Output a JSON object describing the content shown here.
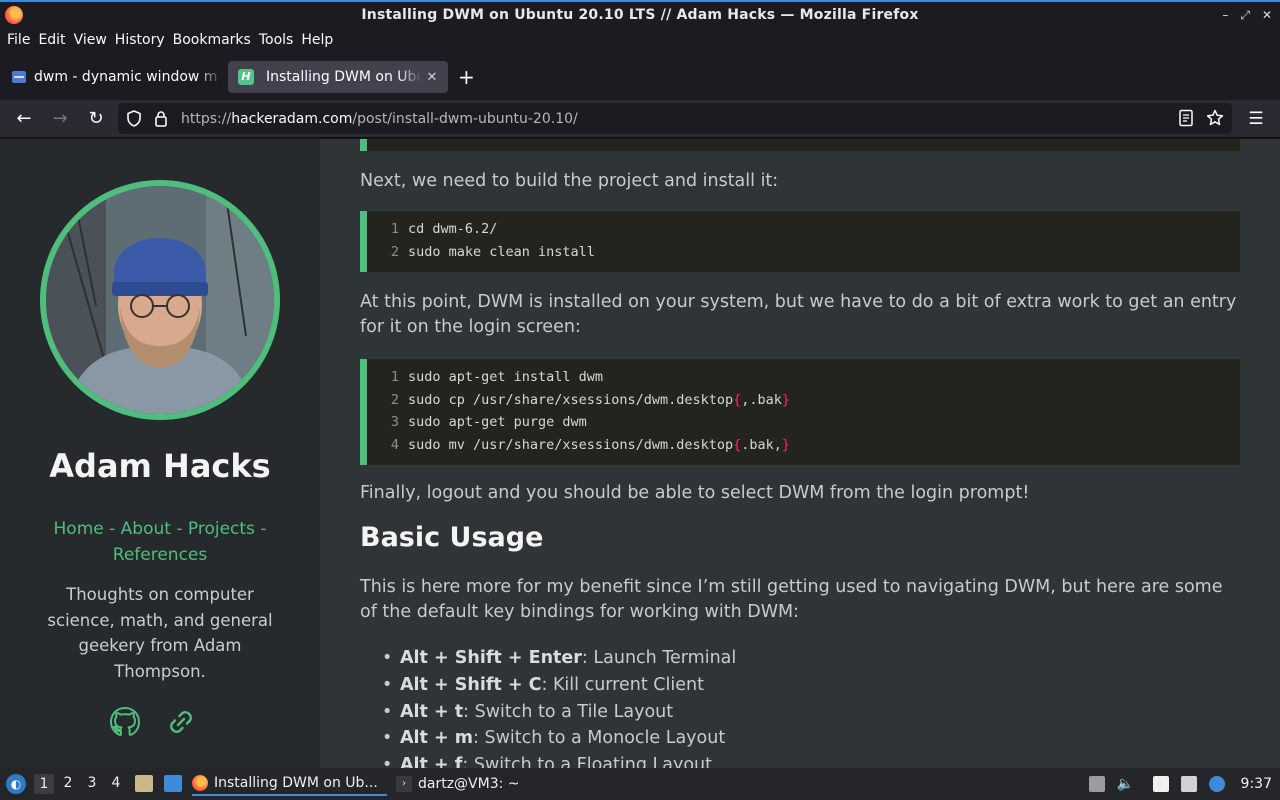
{
  "window": {
    "title": "Installing DWM on Ubuntu 20.10 LTS // Adam Hacks — Mozilla Firefox",
    "controls": [
      "–",
      "⤢",
      "✕"
    ]
  },
  "menu": [
    "File",
    "Edit",
    "View",
    "History",
    "Bookmarks",
    "Tools",
    "Help"
  ],
  "tabs": [
    {
      "label": "dwm - dynamic window m",
      "active": false
    },
    {
      "label": "Installing DWM on Ubuntu",
      "active": true
    }
  ],
  "urlbar": {
    "prefix": "https://",
    "host": "hackeradam.com",
    "path": "/post/install-dwm-ubuntu-20.10/"
  },
  "sidebar": {
    "author": "Adam Hacks",
    "links": [
      "Home",
      "About",
      "Projects",
      "References"
    ],
    "separator": " - ",
    "tagline": "Thoughts on computer science, math, and general geekery from Adam Thompson.",
    "social_icons": [
      "github-icon",
      "link-icon"
    ]
  },
  "article": {
    "para_build": "Next, we need to build the project and install it:",
    "code_build": [
      {
        "n": "1",
        "code": "cd dwm-6.2/"
      },
      {
        "n": "2",
        "code": "sudo make clean install"
      }
    ],
    "para_login": "At this point, DWM is installed on your system, but we have to do a bit of extra work to get an entry for it on the login screen:",
    "code_login": [
      {
        "n": "1",
        "pre": "sudo apt-get install dwm",
        "brace": "",
        "mid": "",
        "end": ""
      },
      {
        "n": "2",
        "pre": "sudo cp /usr/share/xsessions/dwm.desktop",
        "brace": "{",
        "mid": ",.bak",
        "end": "}"
      },
      {
        "n": "3",
        "pre": "sudo apt-get purge dwm",
        "brace": "",
        "mid": "",
        "end": ""
      },
      {
        "n": "4",
        "pre": "sudo mv /usr/share/xsessions/dwm.desktop",
        "brace": "{",
        "mid": ".bak,",
        "end": "}"
      }
    ],
    "para_final": "Finally, logout and you should be able to select DWM from the login prompt!",
    "heading_usage": "Basic Usage",
    "para_usage": "This is here more for my benefit since I’m still getting used to navigating DWM, but here are some of the default key bindings for working with DWM:",
    "bindings": [
      {
        "keys": "Alt + Shift + Enter",
        "desc": ": Launch Terminal"
      },
      {
        "keys": "Alt + Shift + C",
        "desc": ": Kill current Client"
      },
      {
        "keys": "Alt + t",
        "desc": ": Switch to a Tile Layout"
      },
      {
        "keys": "Alt + m",
        "desc": ": Switch to a Monocle Layout"
      },
      {
        "keys": "Alt + f",
        "desc": ": Switch to a Floating Layout"
      }
    ]
  },
  "taskbar": {
    "workspaces": [
      "1",
      "2",
      "3",
      "4"
    ],
    "active_workspace": "1",
    "tasks": [
      {
        "label": "Installing DWM on Ub...",
        "icon": "firefox-icon",
        "active": true
      },
      {
        "label": "dartz@VM3: ~",
        "icon": "terminal-icon",
        "active": false
      }
    ],
    "clock": "9:37"
  }
}
